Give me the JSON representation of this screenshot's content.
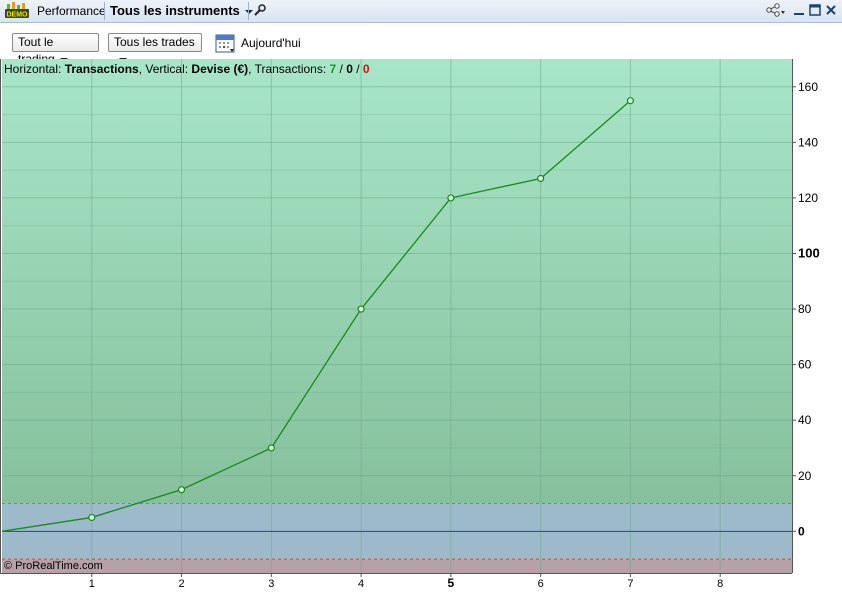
{
  "titlebar": {
    "logo_text": "DEMO",
    "performance_label": "Performance",
    "instrument_label": "Tous les instruments"
  },
  "toolbar": {
    "trading_dropdown": "Tout le trading",
    "trades_dropdown": "Tous les trades",
    "date_label": "Aujourd'hui"
  },
  "legend": {
    "horizontal_prefix": "Horizontal: ",
    "horizontal_value": "Transactions",
    "vertical_prefix": ", Vertical: ",
    "vertical_value": "Devise (€)",
    "transactions_prefix": ", Transactions: ",
    "count_green": "7",
    "slash1": " / ",
    "count_black": "0",
    "slash2": " / ",
    "count_red": "0"
  },
  "watermark": "© ProRealTime.com",
  "colors": {
    "line": "#1a8a1a",
    "positive_top": "#a8e6c9",
    "positive_bottom": "#86c09c",
    "neutral_zone": "#9dbacb",
    "negative_zone": "#b7a0a8",
    "zero_line": "#2040b0"
  },
  "chart_data": {
    "type": "line",
    "x": [
      0,
      1,
      2,
      3,
      4,
      5,
      6,
      7
    ],
    "values": [
      0,
      5,
      15,
      30,
      80,
      120,
      127,
      155
    ],
    "xticks": [
      "1",
      "2",
      "3",
      "4",
      "5",
      "6",
      "7",
      "8"
    ],
    "yticks": [
      "0",
      "20",
      "40",
      "60",
      "80",
      "100",
      "120",
      "140",
      "160"
    ],
    "xlim": [
      0,
      8.8
    ],
    "ylim": [
      -15,
      170
    ],
    "neutral_band": [
      -10,
      10
    ],
    "grid": true
  }
}
